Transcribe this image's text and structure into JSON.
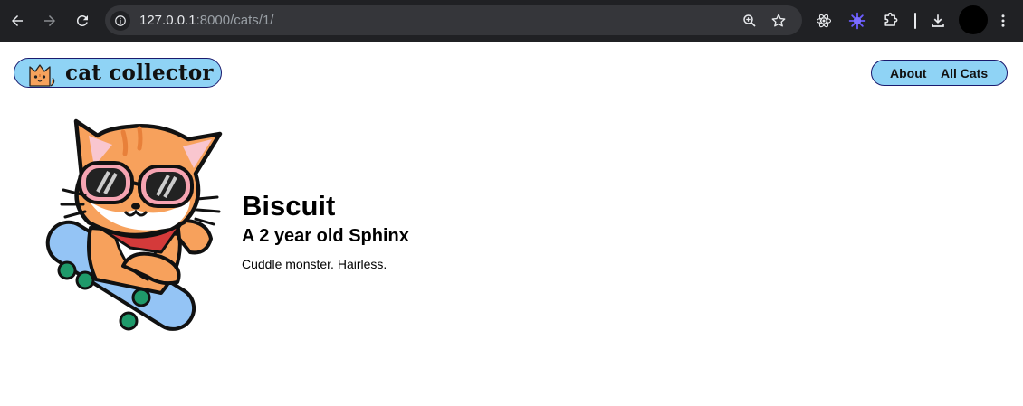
{
  "browser": {
    "url_host": "127.0.0.1",
    "url_rest": ":8000/cats/1/"
  },
  "header": {
    "logo_text": "cat collector",
    "nav": [
      {
        "label": "About"
      },
      {
        "label": "All Cats"
      }
    ]
  },
  "cat": {
    "name": "Biscuit",
    "subtitle": "A 2 year old Sphinx",
    "description": "Cuddle monster. Hairless."
  },
  "colors": {
    "pill_bg": "#8fd3f5",
    "pill_border": "#1a1a6e",
    "chrome_bg": "#202124",
    "omnibox_bg": "#35363a"
  }
}
